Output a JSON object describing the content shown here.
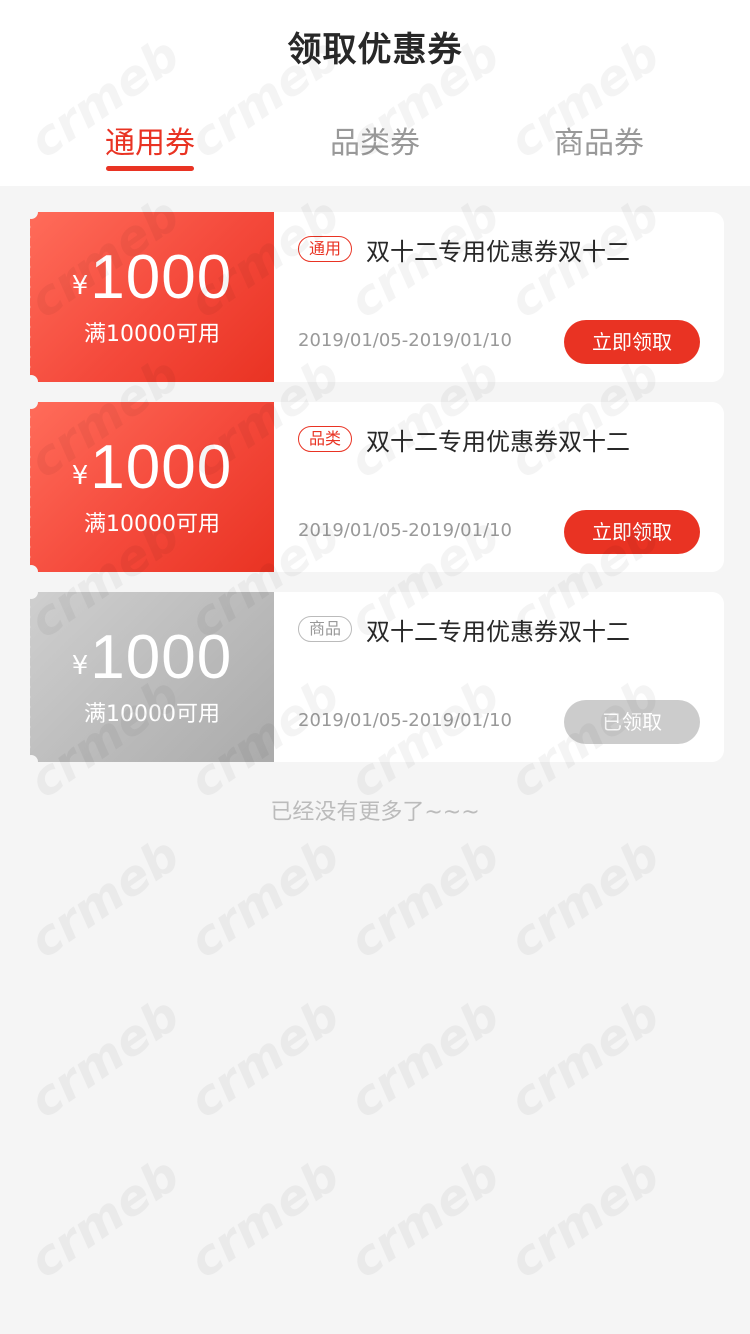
{
  "page": {
    "title": "领取优惠券"
  },
  "tabs": [
    {
      "label": "通用券",
      "active": true
    },
    {
      "label": "品类券",
      "active": false
    },
    {
      "label": "商品券",
      "active": false
    }
  ],
  "coupons": [
    {
      "currency": "¥",
      "amount": "1000",
      "condition": "满10000可用",
      "tag": "通用",
      "name": "双十二专用优惠券双十二",
      "date": "2019/01/05-2019/01/10",
      "button": "立即领取",
      "state": "available"
    },
    {
      "currency": "¥",
      "amount": "1000",
      "condition": "满10000可用",
      "tag": "品类",
      "name": "双十二专用优惠券双十二",
      "date": "2019/01/05-2019/01/10",
      "button": "立即领取",
      "state": "available"
    },
    {
      "currency": "¥",
      "amount": "1000",
      "condition": "满10000可用",
      "tag": "商品",
      "name": "双十二专用优惠券双十二",
      "date": "2019/01/05-2019/01/10",
      "button": "已领取",
      "state": "received"
    }
  ],
  "footer": {
    "no_more": "已经没有更多了~~~"
  },
  "watermark": "crmeb",
  "colors": {
    "accent": "#e93323",
    "disabled": "#cccccc",
    "background": "#f5f5f5"
  }
}
